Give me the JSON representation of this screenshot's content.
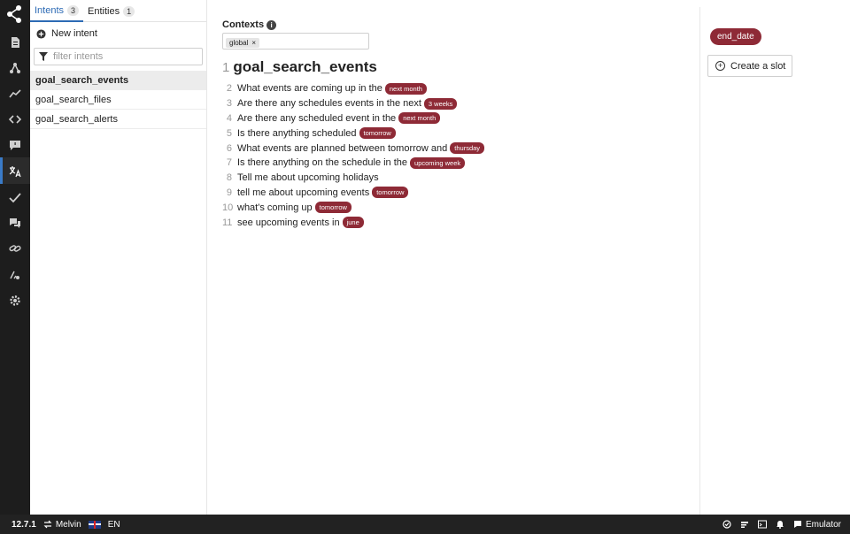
{
  "tabs": [
    {
      "label": "Intents",
      "count": "3"
    },
    {
      "label": "Entities",
      "count": "1"
    }
  ],
  "new_intent_label": "New intent",
  "filter": {
    "placeholder": "filter intents"
  },
  "intents": [
    "goal_search_events",
    "goal_search_files",
    "goal_search_alerts"
  ],
  "selected_intent": "goal_search_events",
  "contexts": {
    "label": "Contexts",
    "chips": [
      "global"
    ]
  },
  "editor": {
    "title_number": "1",
    "title": "goal_search_events",
    "utterances": [
      {
        "n": "2",
        "text": "What events are coming up in the",
        "entity": "next month"
      },
      {
        "n": "3",
        "text": "Are there any schedules events in the next",
        "entity": "3 weeks"
      },
      {
        "n": "4",
        "text": "Are there any scheduled event in the",
        "entity": "next month"
      },
      {
        "n": "5",
        "text": "Is there anything scheduled",
        "entity": "tomorrow"
      },
      {
        "n": "6",
        "text": "What events are planned between tomorrow and",
        "entity": "thursday"
      },
      {
        "n": "7",
        "text": "Is there anything on the schedule in the",
        "entity": "upcoming week"
      },
      {
        "n": "8",
        "text": "Tell me about upcoming holidays",
        "entity": null
      },
      {
        "n": "9",
        "text": "tell me about upcoming events",
        "entity": "tomorrow"
      },
      {
        "n": "10",
        "text": "what's coming up",
        "entity": "tomorrow"
      },
      {
        "n": "11",
        "text": "see upcoming events in",
        "entity": "june"
      }
    ]
  },
  "slots": {
    "pill": "end_date",
    "create_label": "Create a slot"
  },
  "statusbar": {
    "version": "12.7.1",
    "bot": "Melvin",
    "language": "EN",
    "emulator": "Emulator"
  },
  "colors": {
    "entity": "#8e2a36",
    "accent": "#2d6bb5",
    "rail": "#1d1d1d"
  }
}
